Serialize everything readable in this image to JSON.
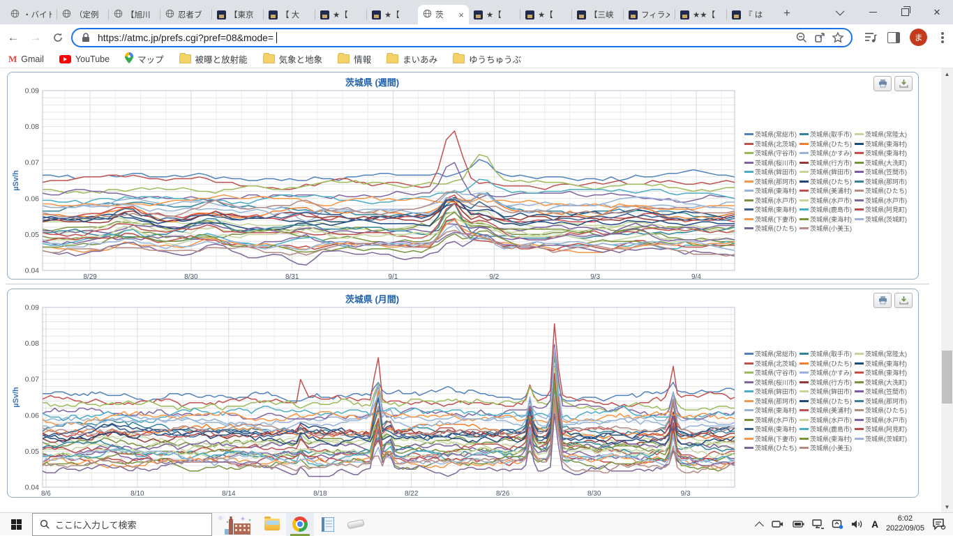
{
  "browser": {
    "tabs": [
      {
        "label": "・バイト",
        "favicon": "globe",
        "active": false
      },
      {
        "label": "（定例",
        "favicon": "globe",
        "active": false
      },
      {
        "label": "【旭川",
        "favicon": "globe",
        "active": false
      },
      {
        "label": "忍者ブ",
        "favicon": "globe",
        "active": false
      },
      {
        "label": "【東京",
        "favicon": "board",
        "active": false
      },
      {
        "label": "【 大",
        "favicon": "board",
        "active": false
      },
      {
        "label": "★【",
        "favicon": "board",
        "active": false
      },
      {
        "label": "★【",
        "favicon": "board",
        "active": false
      },
      {
        "label": "茨",
        "favicon": "globe",
        "active": true
      },
      {
        "label": "★【",
        "favicon": "board",
        "active": false
      },
      {
        "label": "★【",
        "favicon": "board",
        "active": false
      },
      {
        "label": "【三峡",
        "favicon": "board",
        "active": false
      },
      {
        "label": "フィラメ",
        "favicon": "board",
        "active": false
      },
      {
        "label": "★★【",
        "favicon": "board",
        "active": false
      },
      {
        "label": "『 は",
        "favicon": "board",
        "active": false
      }
    ],
    "url": "https://atmc.jp/prefs.cgi?pref=08&mode=",
    "avatar_letter": "ま",
    "bookmarks": [
      {
        "label": "Gmail",
        "icon": "gmail"
      },
      {
        "label": "YouTube",
        "icon": "youtube"
      },
      {
        "label": "マップ",
        "icon": "maps"
      },
      {
        "label": "被曝と放射能",
        "icon": "folder"
      },
      {
        "label": "気象と地象",
        "icon": "folder"
      },
      {
        "label": "情報",
        "icon": "folder"
      },
      {
        "label": "まいあみ",
        "icon": "folder"
      },
      {
        "label": "ゆうちゅうぶ",
        "icon": "folder"
      }
    ]
  },
  "stations": [
    {
      "name": "茨城県(常総市)",
      "color": "#4F81BD",
      "base": 0.066
    },
    {
      "name": "茨城県(取手市)",
      "color": "#31849B",
      "base": 0.056
    },
    {
      "name": "茨城県(常陸太)",
      "color": "#C3D69B",
      "base": 0.053
    },
    {
      "name": "茨城県(北茨城)",
      "color": "#C0504D",
      "base": 0.0645
    },
    {
      "name": "茨城県(ひたち)",
      "color": "#F07F2E",
      "base": 0.0555
    },
    {
      "name": "茨城県(東海村)",
      "color": "#1F497D",
      "base": 0.055
    },
    {
      "name": "茨城県(守谷市)",
      "color": "#9BBB59",
      "base": 0.063
    },
    {
      "name": "茨城県(かすみ)",
      "color": "#95B3D7",
      "base": 0.0585
    },
    {
      "name": "茨城県(東海村)",
      "color": "#CC4B4B",
      "base": 0.0545
    },
    {
      "name": "茨城県(桜川市)",
      "color": "#8064A2",
      "base": 0.061
    },
    {
      "name": "茨城県(行方市)",
      "color": "#953735",
      "base": 0.054
    },
    {
      "name": "茨城県(大洗町)",
      "color": "#77933C",
      "base": 0.052
    },
    {
      "name": "茨城県(鉾田市)",
      "color": "#4BACC6",
      "base": 0.0602
    },
    {
      "name": "茨城県(鉾田市)",
      "color": "#C3D69B",
      "base": 0.0515
    },
    {
      "name": "茨城県(笠間市)",
      "color": "#7A5EA0",
      "base": 0.051
    },
    {
      "name": "茨城県(那珂市)",
      "color": "#F79646",
      "base": 0.059
    },
    {
      "name": "茨城県(ひたち)",
      "color": "#1F497D",
      "base": 0.0535
    },
    {
      "name": "茨城県(那珂市)",
      "color": "#31849B",
      "base": 0.0505
    },
    {
      "name": "茨城県(東海村)",
      "color": "#95B3D7",
      "base": 0.0575
    },
    {
      "name": "茨城県(美浦村)",
      "color": "#C0504D",
      "base": 0.05
    },
    {
      "name": "茨城県(ひたち)",
      "color": "#B48A84",
      "base": 0.0565
    },
    {
      "name": "茨城県(水戸市)",
      "color": "#77933C",
      "base": 0.0495
    },
    {
      "name": "茨城県(水戸市)",
      "color": "#C3D69B",
      "base": 0.049
    },
    {
      "name": "茨城県(水戸市)",
      "color": "#8064A2",
      "base": 0.0485
    },
    {
      "name": "茨城県(東海村)",
      "color": "#376092",
      "base": 0.0548
    },
    {
      "name": "茨城県(鹿島市)",
      "color": "#4BACC6",
      "base": 0.048
    },
    {
      "name": "茨城県(阿見町)",
      "color": "#BE4B48",
      "base": 0.0475
    },
    {
      "name": "茨城県(下妻市)",
      "color": "#F79646",
      "base": 0.047
    },
    {
      "name": "茨城県(東海村)",
      "color": "#77933C",
      "base": 0.0465
    },
    {
      "name": "茨城県(茨城町)",
      "color": "#95B3D7",
      "base": 0.0478
    },
    {
      "name": "茨城県(ひたち)",
      "color": "#7C6699",
      "base": 0.045
    },
    {
      "name": "茨城県(小美玉)",
      "color": "#B48A84",
      "base": 0.046
    }
  ],
  "chart_data": [
    {
      "type": "line",
      "title": "茨城県 (週間)",
      "ylabel": "µSv/h",
      "ylim": [
        0.04,
        0.09
      ],
      "yticks": [
        0.04,
        0.05,
        0.06,
        0.07,
        0.08,
        0.09
      ],
      "y_minor_step": 0.002,
      "xticks": [
        "8/29",
        "8/30",
        "8/31",
        "9/1",
        "9/2",
        "9/3",
        "9/4"
      ],
      "x_total_days": 6.85,
      "x_first_tick_day": 0.47,
      "x_tick_interval_days": 1,
      "x_minor_step_days": 0.25,
      "points_per_series": 85,
      "series_note": "32 station series (see stations list for name/color/baseline µSv/h); lines fluctuate ±0.002 around baselines",
      "spikes": [
        {
          "t": 0.83,
          "sigma": 0.16,
          "named": {},
          "lower": [
            0.0,
            0.0035
          ]
        },
        {
          "t": 1.66,
          "sigma": 0.13,
          "named": {},
          "lower": [
            0.0,
            0.003
          ]
        },
        {
          "t": 2.6,
          "sigma": 0.1,
          "named": {
            "7": -0.0045,
            "30": -0.0035
          },
          "lower": [
            -0.0008,
            0.0018
          ]
        },
        {
          "t": 4.05,
          "sigma": 0.09,
          "named": {
            "3": 0.016,
            "9": 0.0105,
            "16": 0.0075
          },
          "lower": [
            0.002,
            0.0095
          ]
        },
        {
          "t": 4.35,
          "sigma": 0.11,
          "named": {
            "6": 0.0085,
            "0": 0.0045,
            "12": 0.004
          },
          "lower": [
            0.0005,
            0.005
          ]
        },
        {
          "t": 5.9,
          "sigma": 0.14,
          "named": {},
          "lower": [
            0.0,
            0.002
          ]
        }
      ],
      "peak_readings": "北茨城 peaks ≈0.080 µSv/h just before 9/2; 桜川市 ≈0.071; 守谷市 ≈0.071; 常総市 ≈0.070"
    },
    {
      "type": "line",
      "title": "茨城県 (月間)",
      "ylabel": "µSv/h",
      "ylim": [
        0.04,
        0.09
      ],
      "yticks": [
        0.04,
        0.05,
        0.06,
        0.07,
        0.08,
        0.09
      ],
      "y_minor_step": 0.002,
      "xticks": [
        "8/6",
        "8/10",
        "8/14",
        "8/18",
        "8/22",
        "8/26",
        "8/30",
        "9/3"
      ],
      "x_total_days": 30.3,
      "x_first_tick_day": 0.15,
      "x_tick_interval_days": 4,
      "x_minor_step_days": 1,
      "points_per_series": 170,
      "series_note": "same 32 station series as weekly chart",
      "spikes": [
        {
          "t": 3.0,
          "sigma": 0.5,
          "named": {},
          "lower": [
            0.0,
            0.0015
          ]
        },
        {
          "t": 11.35,
          "sigma": 0.1,
          "named": {
            "3": 0.0075
          },
          "lower": [
            0.0,
            0.003
          ]
        },
        {
          "t": 14.65,
          "sigma": 0.11,
          "named": {
            "3": 0.014,
            "9": 0.0095,
            "6": 0.006,
            "0": 0.0035
          },
          "lower": [
            0.003,
            0.0125
          ]
        },
        {
          "t": 15.15,
          "sigma": 0.09,
          "named": {},
          "lower": [
            0.001,
            0.006
          ]
        },
        {
          "t": 21.35,
          "sigma": 0.1,
          "named": {
            "3": 0.0045,
            "6": 0.004,
            "0": 0.0022
          },
          "lower": [
            0.002,
            0.009
          ]
        },
        {
          "t": 22.45,
          "sigma": 0.1,
          "named": {
            "3": 0.0215,
            "9": 0.0185,
            "6": 0.015,
            "0": 0.006,
            "18": 0.023
          },
          "lower": [
            0.012,
            0.026
          ]
        },
        {
          "t": 27.6,
          "sigma": 0.1,
          "named": {
            "3": 0.0092,
            "9": 0.007,
            "6": 0.0046,
            "0": 0.0022
          },
          "lower": [
            0.003,
            0.011
          ]
        }
      ],
      "peak_readings": "sharp all-station spike ≈8/28 topping at ≈0.086 µSv/h; cluster spike ≈8/20 to ≈0.078; spike ≈9/2 to ≈0.073"
    }
  ],
  "taskbar": {
    "search_placeholder": "ここに入力して検索",
    "clock_time": "6:02",
    "clock_date": "2022/09/05",
    "ime": "A"
  }
}
